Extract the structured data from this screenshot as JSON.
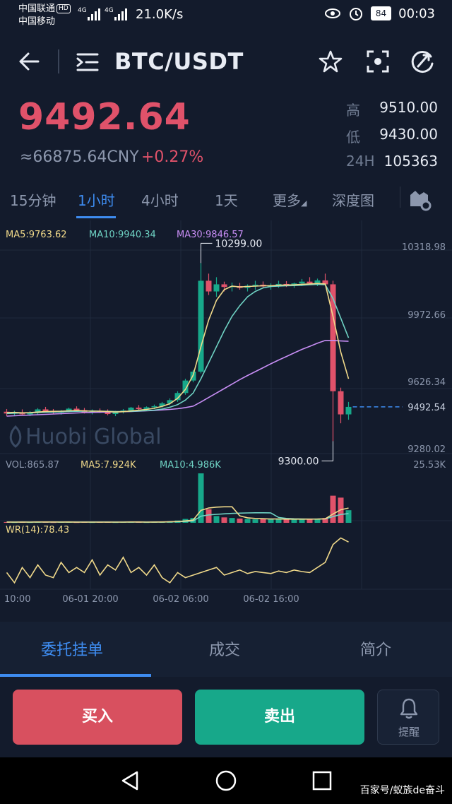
{
  "status_bar": {
    "carrier1": "中国联通",
    "carrier1_badge": "HD",
    "carrier2": "中国移动",
    "signal1": "4G",
    "signal2": "4G",
    "net_speed": "21.0K/s",
    "battery": "84",
    "time": "00:03"
  },
  "header": {
    "title": "BTC/USDT",
    "icons": [
      "back-arrow-icon",
      "menu-list-icon",
      "star-icon",
      "scan-icon",
      "share-icon"
    ]
  },
  "ticker": {
    "price": "9492.64",
    "cny": "≈66875.64CNY",
    "change": "+0.27%",
    "high_label": "高",
    "high": "9510.00",
    "low_label": "低",
    "low": "9430.00",
    "vol_label": "24H",
    "vol": "105363"
  },
  "intervals": [
    {
      "label": "15分钟",
      "active": false
    },
    {
      "label": "1小时",
      "active": true
    },
    {
      "label": "4小时",
      "active": false
    },
    {
      "label": "1天",
      "active": false
    },
    {
      "label": "更多",
      "active": false
    },
    {
      "label": "深度图",
      "active": false
    }
  ],
  "colors": {
    "up": "#e0526a",
    "down": "#17a88a",
    "ma5": "#f0d98a",
    "ma10": "#6fd3c4",
    "ma30": "#c88ef5",
    "accent": "#3e8cf0"
  },
  "chart": {
    "ma5_label": "MA5:9763.62",
    "ma10_label": "MA10:9940.34",
    "ma30_label": "MA30:9846.57",
    "price_ticks": [
      "10318.98",
      "9972.66",
      "9626.34",
      "9280.02"
    ],
    "current_price_tag": "9492.54",
    "high_marker": "10299.00",
    "low_marker": "9300.00",
    "watermark": "Huobi Global",
    "vol_label": "VOL:865.87",
    "vol_ma5_label": "MA5:7.924K",
    "vol_ma10_label": "MA10:4.986K",
    "vol_max": "25.53K",
    "wr_label": "WR(14):78.43",
    "time_ticks": [
      "10:00",
      "06-01 20:00",
      "06-02 06:00",
      "06-02 16:00"
    ]
  },
  "chart_data": {
    "type": "candlestick",
    "ylim": [
      9230,
      10380
    ],
    "candles": [
      [
        9465,
        9480,
        9440,
        9455
      ],
      [
        9455,
        9470,
        9440,
        9462
      ],
      [
        9462,
        9478,
        9448,
        9450
      ],
      [
        9450,
        9468,
        9440,
        9458
      ],
      [
        9458,
        9485,
        9450,
        9478
      ],
      [
        9478,
        9492,
        9460,
        9466
      ],
      [
        9466,
        9480,
        9452,
        9460
      ],
      [
        9460,
        9475,
        9448,
        9470
      ],
      [
        9470,
        9488,
        9462,
        9482
      ],
      [
        9482,
        9495,
        9468,
        9474
      ],
      [
        9474,
        9486,
        9455,
        9462
      ],
      [
        9462,
        9478,
        9450,
        9470
      ],
      [
        9470,
        9483,
        9458,
        9465
      ],
      [
        9465,
        9478,
        9445,
        9452
      ],
      [
        9452,
        9470,
        9440,
        9466
      ],
      [
        9466,
        9480,
        9455,
        9472
      ],
      [
        9472,
        9492,
        9465,
        9488
      ],
      [
        9488,
        9502,
        9475,
        9480
      ],
      [
        9480,
        9495,
        9470,
        9490
      ],
      [
        9490,
        9505,
        9480,
        9496
      ],
      [
        9496,
        9520,
        9488,
        9512
      ],
      [
        9512,
        9540,
        9502,
        9530
      ],
      [
        9530,
        9580,
        9520,
        9570
      ],
      [
        9570,
        9650,
        9560,
        9640
      ],
      [
        9640,
        9700,
        9630,
        9690
      ],
      [
        9690,
        10299,
        9680,
        10200
      ],
      [
        10200,
        10240,
        10120,
        10140
      ],
      [
        10140,
        10220,
        10110,
        10180
      ],
      [
        10180,
        10195,
        10140,
        10165
      ],
      [
        10165,
        10190,
        10140,
        10170
      ],
      [
        10170,
        10188,
        10150,
        10160
      ],
      [
        10160,
        10180,
        10140,
        10172
      ],
      [
        10172,
        10200,
        10150,
        10178
      ],
      [
        10178,
        10196,
        10160,
        10168
      ],
      [
        10168,
        10185,
        10150,
        10175
      ],
      [
        10175,
        10200,
        10160,
        10182
      ],
      [
        10182,
        10198,
        10165,
        10172
      ],
      [
        10172,
        10190,
        10160,
        10185
      ],
      [
        10185,
        10210,
        10170,
        10195
      ],
      [
        10195,
        10220,
        10178,
        10185
      ],
      [
        10185,
        10212,
        10170,
        10202
      ],
      [
        10202,
        10240,
        10190,
        10180
      ],
      [
        10180,
        10200,
        9300,
        9580
      ],
      [
        9580,
        9600,
        9400,
        9450
      ],
      [
        9450,
        9520,
        9420,
        9492
      ]
    ],
    "ma5": [
      9460,
      9461,
      9459,
      9460,
      9463,
      9466,
      9467,
      9468,
      9470,
      9472,
      9470,
      9468,
      9468,
      9466,
      9463,
      9465,
      9469,
      9474,
      9478,
      9484,
      9495,
      9510,
      9540,
      9590,
      9670,
      9830,
      9980,
      10090,
      10150,
      10170,
      10165,
      10168,
      10170,
      10172,
      10172,
      10175,
      10176,
      10177,
      10180,
      10182,
      10185,
      10182,
      10000,
      9800,
      9650
    ],
    "ma10": [
      9455,
      9457,
      9458,
      9459,
      9460,
      9462,
      9463,
      9464,
      9466,
      9467,
      9468,
      9469,
      9468,
      9467,
      9466,
      9466,
      9467,
      9469,
      9471,
      9474,
      9480,
      9490,
      9505,
      9530,
      9570,
      9650,
      9740,
      9830,
      9920,
      10000,
      10060,
      10110,
      10140,
      10160,
      10168,
      10170,
      10172,
      10173,
      10175,
      10178,
      10180,
      10178,
      10100,
      9990,
      9880
    ],
    "ma30": [
      9440,
      9442,
      9444,
      9446,
      9448,
      9450,
      9452,
      9454,
      9456,
      9458,
      9460,
      9461,
      9462,
      9463,
      9464,
      9465,
      9466,
      9468,
      9470,
      9472,
      9475,
      9478,
      9482,
      9488,
      9496,
      9520,
      9545,
      9570,
      9595,
      9620,
      9645,
      9668,
      9690,
      9712,
      9734,
      9755,
      9775,
      9795,
      9815,
      9832,
      9850,
      9865,
      9865,
      9862,
      9860
    ],
    "volume": [
      0.4,
      0.3,
      0.5,
      0.3,
      0.6,
      0.4,
      0.3,
      0.4,
      0.5,
      0.3,
      0.4,
      0.3,
      0.4,
      0.5,
      0.3,
      0.4,
      0.5,
      0.4,
      0.3,
      0.4,
      0.6,
      0.8,
      1.2,
      2.0,
      2.5,
      25.53,
      7.0,
      3.5,
      2.8,
      2.5,
      2.2,
      2.0,
      1.8,
      2.0,
      1.9,
      2.1,
      1.7,
      1.8,
      1.9,
      2.0,
      2.2,
      2.5,
      14.0,
      13.0,
      6.5
    ],
    "wr": [
      30,
      10,
      40,
      20,
      45,
      25,
      20,
      50,
      30,
      40,
      30,
      55,
      25,
      45,
      35,
      60,
      30,
      40,
      25,
      45,
      20,
      10,
      30,
      20,
      25,
      30,
      35,
      40,
      25,
      30,
      35,
      28,
      32,
      30,
      28,
      33,
      30,
      35,
      32,
      30,
      40,
      50,
      85,
      98,
      90
    ]
  },
  "bottom_tabs": [
    "委托挂单",
    "成交",
    "简介"
  ],
  "actions": {
    "buy": "买入",
    "sell": "卖出",
    "alert": "提醒"
  },
  "watermark": "百家号/蚁族de奋斗"
}
